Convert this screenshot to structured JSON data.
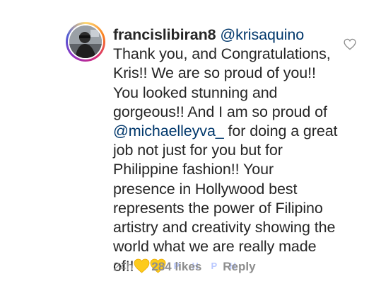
{
  "comment": {
    "username": "francislibiran8",
    "mention": "@krisaquino",
    "text_part1": "Thank you, and Congratulations, Kris!! We are so proud of you!! You looked stunning and gorgeous!! And I am so proud of ",
    "mention2": "@michaelleyva_",
    "text_part2": " for doing a great job not just for you but for Philippine fashion!! Your presence in Hollywood best represents the power of Filipino artistry and creativity showing the world what we are really made of!!",
    "emoji_tail": "P H P H"
  },
  "meta": {
    "time": "24h",
    "likes": "284 likes",
    "reply": "Reply"
  },
  "icons": {
    "like": "heart-outline-icon",
    "emoji": "yellow-heart-icon"
  },
  "colors": {
    "text": "#262626",
    "muted": "#8e8e8e",
    "mention": "#00376b",
    "heart_emoji": "#fdcb1c"
  }
}
